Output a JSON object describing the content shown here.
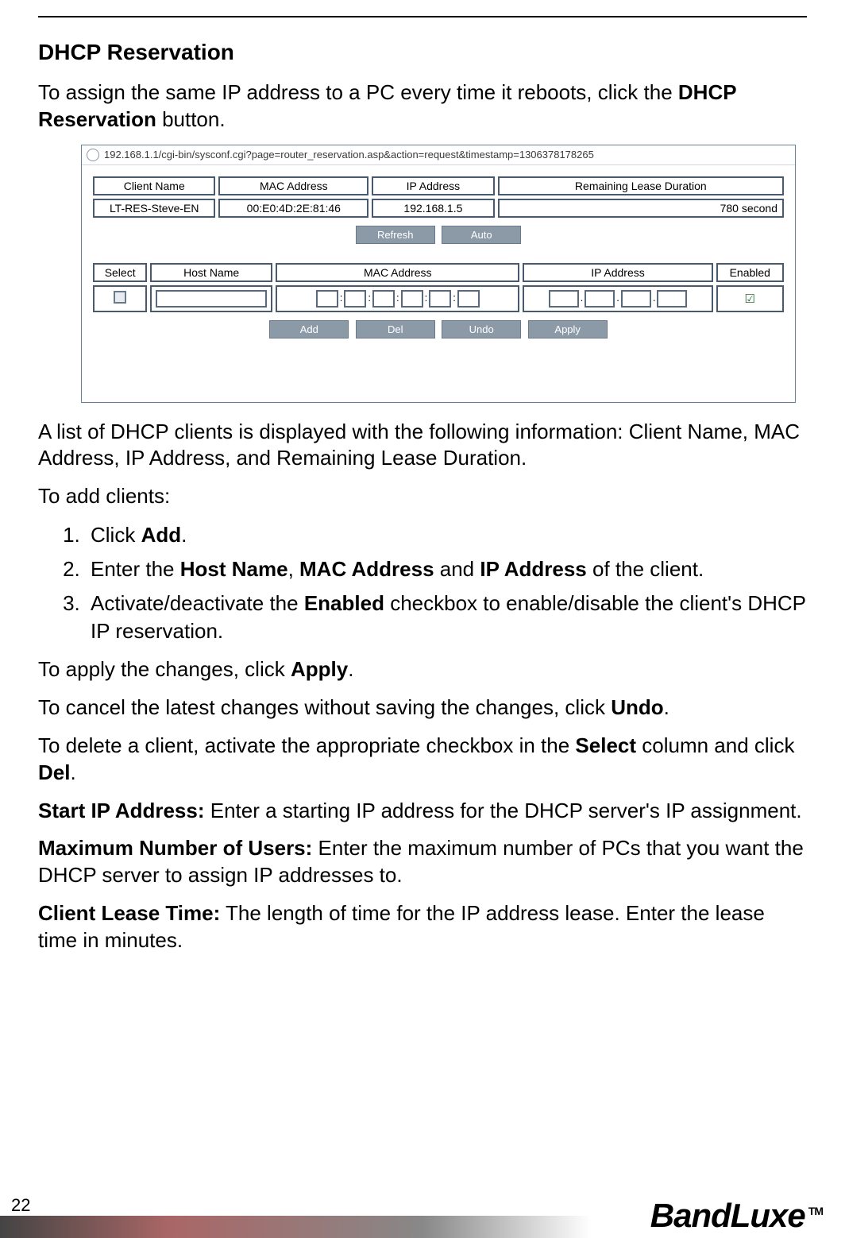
{
  "heading": "DHCP Reservation",
  "intro_pre": "To assign the same IP address to a PC every time it reboots, click the ",
  "intro_bold": "DHCP Reservation",
  "intro_post": " button.",
  "screenshot": {
    "url": "192.168.1.1/cgi-bin/sysconf.cgi?page=router_reservation.asp&action=request&timestamp=1306378178265",
    "lease_headers": {
      "client_name": "Client Name",
      "mac": "MAC Address",
      "ip": "IP Address",
      "remaining": "Remaining Lease Duration"
    },
    "lease_row": {
      "client_name": "LT-RES-Steve-EN",
      "mac": "00:E0:4D:2E:81:46",
      "ip": "192.168.1.5",
      "remaining": "780 second"
    },
    "buttons_top": {
      "refresh": "Refresh",
      "auto": "Auto"
    },
    "res_headers": {
      "select": "Select",
      "host": "Host Name",
      "mac": "MAC Address",
      "ip": "IP Address",
      "enabled": "Enabled"
    },
    "sep_colon": ":",
    "sep_dot": ".",
    "buttons_bottom": {
      "add": "Add",
      "del": "Del",
      "undo": "Undo",
      "apply": "Apply"
    }
  },
  "para_list_info": "A list of DHCP clients is displayed with the following information: Client Name, MAC Address, IP Address, and Remaining Lease Duration.",
  "para_add_clients": "To add clients:",
  "steps": {
    "s1_pre": "Click ",
    "s1_b1": "Add",
    "s1_post": ".",
    "s2_pre": "Enter the ",
    "s2_b1": "Host Name",
    "s2_mid1": ", ",
    "s2_b2": "MAC Address",
    "s2_mid2": " and ",
    "s2_b3": "IP Address",
    "s2_post": " of the client.",
    "s3_pre": "Activate/deactivate the ",
    "s3_b1": "Enabled",
    "s3_post": " checkbox to enable/disable the client's DHCP IP reservation."
  },
  "para_apply_pre": "To apply the changes, click ",
  "para_apply_b": "Apply",
  "para_apply_post": ".",
  "para_undo_pre": "To cancel the latest changes without saving the changes, click ",
  "para_undo_b": "Undo",
  "para_undo_post": ".",
  "para_del_pre": "To delete a client, activate the appropriate checkbox in the ",
  "para_del_b1": "Select",
  "para_del_mid": " column and click ",
  "para_del_b2": "Del",
  "para_del_post": ".",
  "para_start_b": "Start IP Address:",
  "para_start_post": " Enter a starting IP address for the DHCP server's IP assignment.",
  "para_max_b": "Maximum Number of Users:",
  "para_max_post": " Enter the maximum number of PCs that you want the DHCP server to assign IP addresses to.",
  "para_lease_b": "Client Lease Time:",
  "para_lease_post": " The length of time for the IP address lease. Enter the lease time in minutes.",
  "page_number": "22",
  "brand": "BandLuxe",
  "tm": "TM"
}
